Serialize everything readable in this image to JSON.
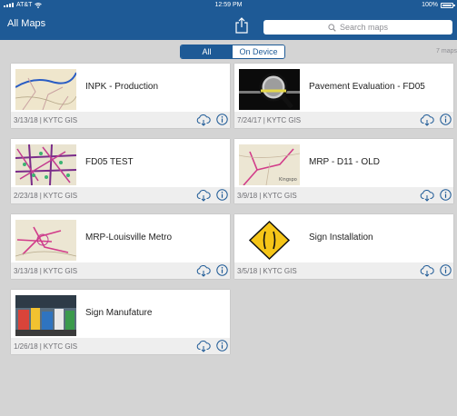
{
  "status_bar": {
    "carrier": "AT&T",
    "time": "12:59 PM",
    "battery": "100%"
  },
  "nav": {
    "title": "All Maps",
    "search_placeholder": "Search maps"
  },
  "filter": {
    "segments": [
      "All",
      "On Device"
    ],
    "selected": "All",
    "count": "7 maps"
  },
  "maps": [
    {
      "title": "INPK - Production",
      "date": "3/13/18",
      "owner": "KYTC GIS",
      "thumb": "map-roads"
    },
    {
      "title": "Pavement Evaluation - FD05",
      "date": "7/24/17",
      "owner": "KYTC GIS",
      "thumb": "magnifier-photo"
    },
    {
      "title": "FD05 TEST",
      "date": "2/23/18",
      "owner": "KYTC GIS",
      "thumb": "map-dense"
    },
    {
      "title": "MRP - D11 - OLD",
      "date": "3/9/18",
      "owner": "KYTC GIS",
      "thumb": "map-roads"
    },
    {
      "title": "MRP-Louisville Metro",
      "date": "3/13/18",
      "owner": "KYTC GIS",
      "thumb": "map-metro"
    },
    {
      "title": "Sign Installation",
      "date": "3/5/18",
      "owner": "KYTC GIS",
      "thumb": "sign-diamond"
    },
    {
      "title": "Sign Manufature",
      "date": "1/26/18",
      "owner": "KYTC GIS",
      "thumb": "sign-shop-photo"
    }
  ],
  "colors": {
    "nav": "#1e5a96",
    "accent": "#1e5a96",
    "background": "#d4d4d4"
  }
}
